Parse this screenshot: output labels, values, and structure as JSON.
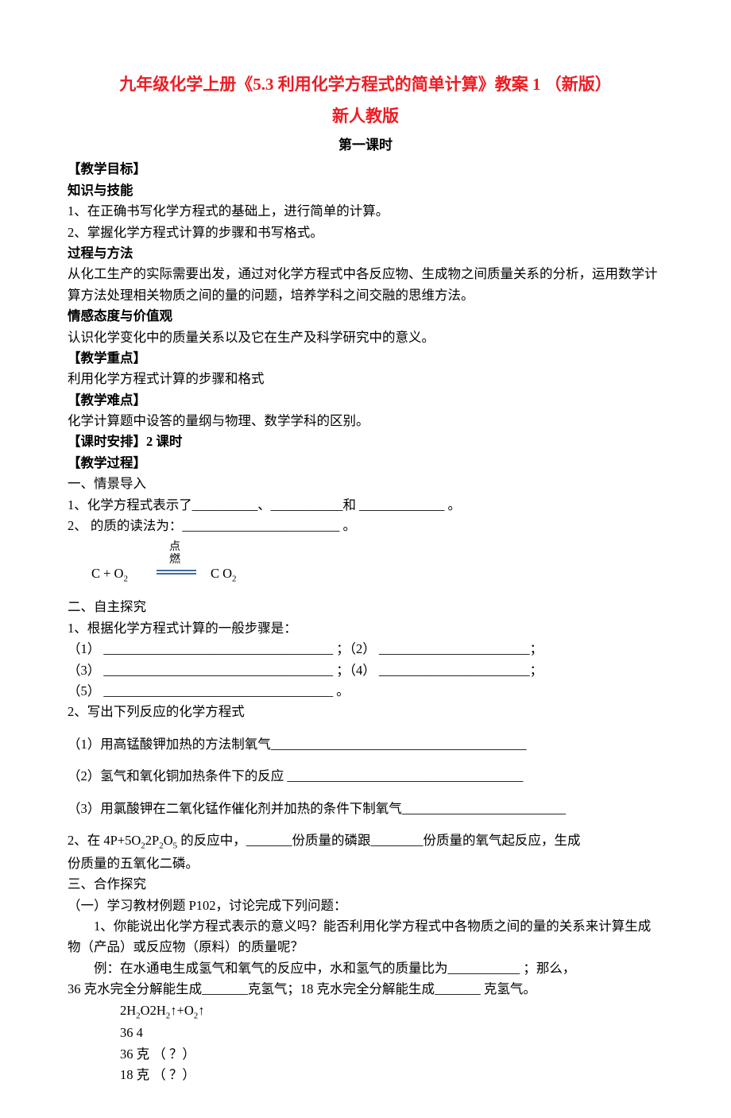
{
  "title_line1": "九年级化学上册《5.3 利用化学方程式的简单计算》教案 1 （新版）",
  "title_line2": "新人教版",
  "subtitle": "第一课时",
  "sec_objectives": "【教学目标】",
  "h_knowledge": "知识与技能",
  "knowledge_1": "1、在正确书写化学方程式的基础上，进行简单的计算。",
  "knowledge_2": "2、掌握化学方程式计算的步骤和书写格式。",
  "h_process": "过程与方法",
  "process_1": "从化工生产的实际需要出发，通过对化学方程式中各反应物、生成物之间质量关系的分析，运用数学计算方法处理相关物质之间的量的问题，培养学科之间交融的思维方法。",
  "h_emotion": "情感态度与价值观",
  "emotion_1": "认识化学变化中的质量关系以及它在生产及科学研究中的意义。",
  "sec_keypoints": "【教学重点】",
  "keypoints_1": "利用化学方程式计算的步骤和格式",
  "sec_difficulty": "【教学难点】",
  "difficulty_1": "化学计算题中设答的量纲与物理、数学学科的区别。",
  "sec_periods": "【课时安排】2 课时",
  "sec_procedure": "【教学过程】",
  "step1": "一、情景导入",
  "step1_q1": "1、化学方程式表示了__________、___________和 _____________ 。",
  "step1_q2": "2、                                  的质的读法为：________________________   。",
  "eq_left": "C   +    O",
  "eq_left_sub": "2",
  "eq_cond1": "点",
  "eq_cond2": "燃",
  "eq_right": "C O",
  "eq_right_sub": "2",
  "step2": "二、自主探究",
  "step2_1": "1、根据化学方程式计算的一般步骤是：",
  "step2_1_1": "（1）  ___________________________________ ；（2）  _______________________；",
  "step2_1_3": "（3）  ___________________________________ ；（4）  _______________________；",
  "step2_1_5": "（5）  ___________________________________ 。",
  "step2_2": "2、写出下列反应的化学方程式",
  "step2_2_1": "（1）用高锰酸钾加热的方法制氧气_______________________________________",
  "step2_2_2": "（2）氢气和氧化铜加热条件下的反应 ____________________________________",
  "step2_2_3": "（3）用氯酸钾在二氧化锰作催化剂并加热的条件下制氧气_________________________",
  "step2_3a": "2、在 4P+5O",
  "step2_3b": "2P",
  "step2_3c": "O",
  "step2_3d": " 的反应中，_______份质量的磷跟________份质量的氧气起反应，生成",
  "step2_sub22": "2",
  "step2_sub25": "5",
  "step2_3_line2": "份质量的五氧化二磷。",
  "step3": "三、合作探究",
  "step3_1": "（一）学习教材例题 P102，讨论完成下列问题：",
  "step3_1_q1": "1、你能说出化学方程式表示的意义吗？能否利用化学方程式中各物质之间的量的关系来计算生成物（产品）或反应物（原料）的质量呢？",
  "step3_ex_a": "例：在水通电生成氢气和氧气的反应中，水和氢气的质量比为___________ ；那么，",
  "step3_ex_b": "36 克水完全分解能生成_______克氢气；18 克水完全分解能生成_______ 克氢气。",
  "calc_l1a": "2H",
  "calc_l1b": "O2H",
  "calc_l1c": "↑+O",
  "calc_l1d": "↑",
  "calc_sub2": "2",
  "calc_l2": " 36        4",
  "calc_l3a": "36",
  "calc_l3b": " 克   （ ？）",
  "calc_l4a": "18",
  "calc_l4b": " 克   （ ？）"
}
